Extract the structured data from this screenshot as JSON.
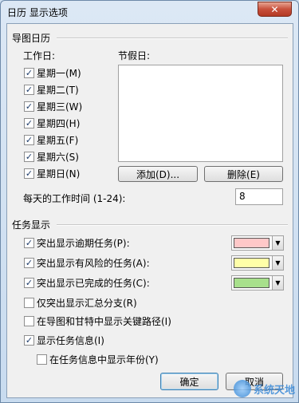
{
  "window": {
    "title": "日历 显示选项",
    "close_label": "✕"
  },
  "gantt_calendar": {
    "group_title": "导图日历",
    "workdays_label": "工作日:",
    "holidays_label": "节假日:",
    "days": [
      {
        "label": "星期一(M)",
        "checked": true
      },
      {
        "label": "星期二(T)",
        "checked": true
      },
      {
        "label": "星期三(W)",
        "checked": true
      },
      {
        "label": "星期四(H)",
        "checked": true
      },
      {
        "label": "星期五(F)",
        "checked": true
      },
      {
        "label": "星期六(S)",
        "checked": true
      },
      {
        "label": "星期日(N)",
        "checked": true
      }
    ],
    "add_button": "添加(D)...",
    "delete_button": "删除(E)",
    "hours_label": "每天的工作时间 (1-24):",
    "hours_value": "8"
  },
  "task_display": {
    "group_title": "任务显示",
    "options": [
      {
        "label": "突出显示逾期任务(P):",
        "checked": true,
        "color": "#ffc8c8"
      },
      {
        "label": "突出显示有风险的任务(A):",
        "checked": true,
        "color": "#ffffa8"
      },
      {
        "label": "突出显示已完成的任务(C):",
        "checked": true,
        "color": "#a8e08c"
      },
      {
        "label": "仅突出显示汇总分支(R)",
        "checked": false
      },
      {
        "label": "在导图和甘特中显示关键路径(I)",
        "checked": false
      },
      {
        "label": "显示任务信息(I)",
        "checked": true
      },
      {
        "label": "在任务信息中显示年份(Y)",
        "checked": false
      }
    ]
  },
  "footer": {
    "ok_button": "确定",
    "cancel_button": "取消"
  },
  "watermark": {
    "text": "系统天地"
  },
  "check_mark": "✓"
}
